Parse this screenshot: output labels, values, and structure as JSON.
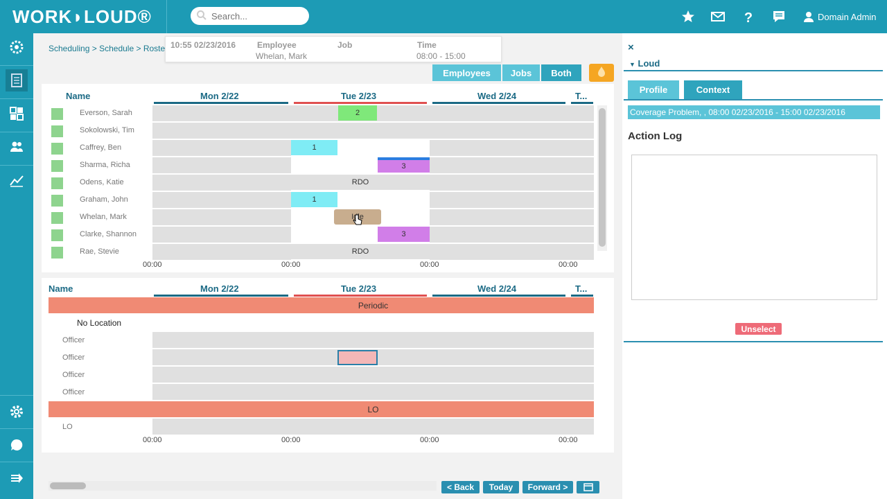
{
  "app": {
    "logo": "WORK◗LOUD®"
  },
  "search": {
    "placeholder": "Search..."
  },
  "user": {
    "name": "Domain Admin"
  },
  "breadcrumb": {
    "a": "Scheduling",
    "b": "Schedule",
    "c": "Roste",
    "sep": ">"
  },
  "tooltip": {
    "datetime": "10:55 02/23/2016",
    "employee_h": "Employee",
    "job_h": "Job",
    "time_h": "Time",
    "employee": "Whelan, Mark",
    "time": "08:00 - 15:00"
  },
  "view_toggle": {
    "employees": "Employees",
    "jobs": "Jobs",
    "both": "Both",
    "selected": "Both"
  },
  "grid": {
    "name_h": "Name",
    "days": [
      "Mon 2/22",
      "Tue 2/23",
      "Wed 2/24",
      "T..."
    ],
    "time_label": "00:00",
    "employees": [
      "Everson, Sarah",
      "Sokolowski, Tim",
      "Caffrey, Ben",
      "Sharma, Richa",
      "Odens, Katie",
      "Graham, John",
      "Whelan, Mark",
      "Clarke, Shannon",
      "Rae, Stevie"
    ],
    "blocks": {
      "everson_tue": "2",
      "caffrey_tue": "1",
      "sharma_tue": "3",
      "odens_tue": "RDO",
      "graham_tue": "1",
      "whelan_tue": "Idle",
      "clarke_tue": "3",
      "rae_tue": "RDO"
    }
  },
  "jobs": {
    "name_h": "Name",
    "days": [
      "Mon 2/22",
      "Tue 2/23",
      "Wed 2/24",
      "T..."
    ],
    "band1": "Periodic",
    "location": "No Location",
    "roles": [
      "Officer",
      "Officer",
      "Officer",
      "Officer"
    ],
    "band2": "LO",
    "lo_row": "LO",
    "time_label": "00:00"
  },
  "nav": {
    "back": "< Back",
    "today": "Today",
    "forward": "Forward >"
  },
  "right_panel": {
    "close": "×",
    "title": "Loud",
    "tab_profile": "Profile",
    "tab_context": "Context",
    "active_tab": "Context",
    "coverage": "Coverage Problem, , 08:00 02/23/2016 - 15:00 02/23/2016",
    "action_log": "Action Log",
    "unselect": "Unselect"
  },
  "colors": {
    "brand": "#1d9bb5",
    "band": "#f08a74",
    "unselect": "#ee6b78"
  }
}
